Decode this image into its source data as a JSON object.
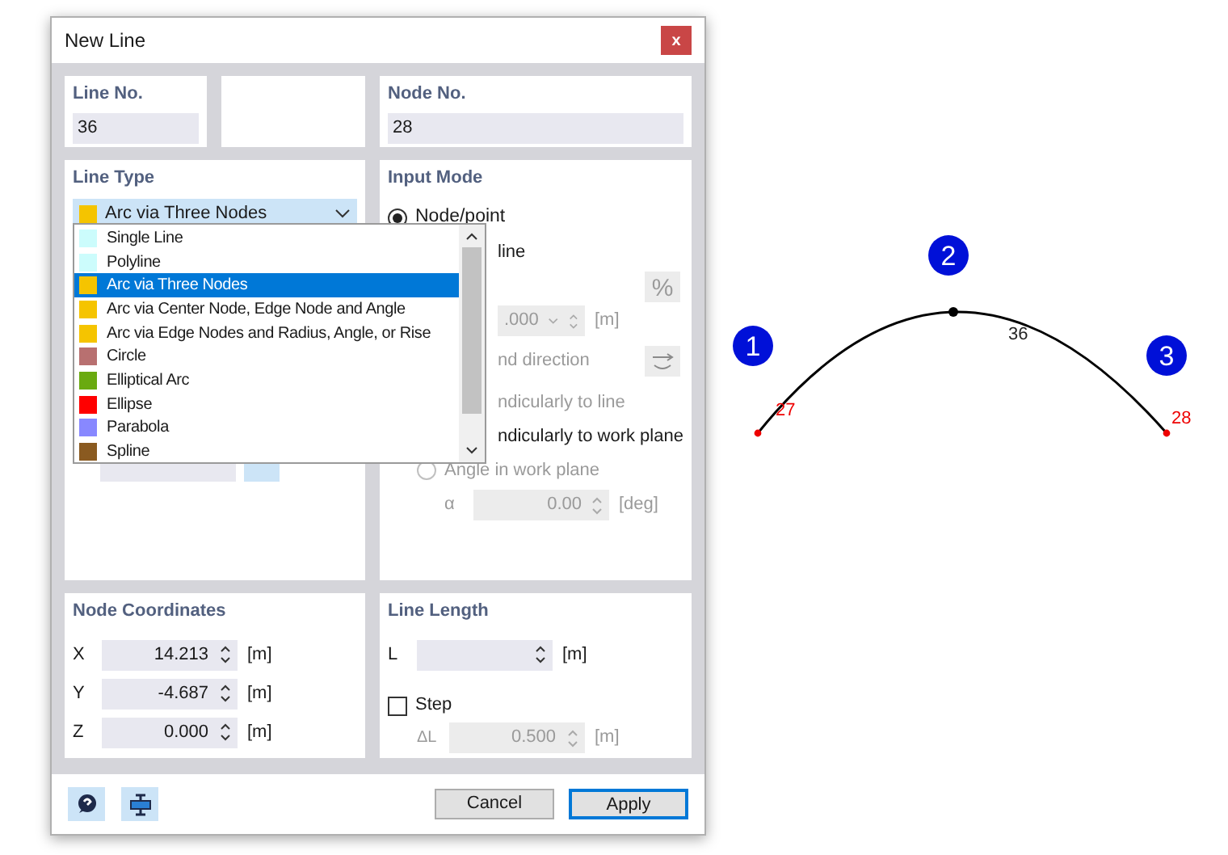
{
  "window": {
    "title": "New Line",
    "close": "x"
  },
  "line_no": {
    "label": "Line No.",
    "value": "36"
  },
  "node_no": {
    "label": "Node No.",
    "value": "28"
  },
  "line_type": {
    "label": "Line Type",
    "value": "Arc via Three Nodes",
    "color": "#f5c400",
    "expanded": true,
    "items": [
      {
        "label": "Single Line",
        "color": "#ccfcfc",
        "selected": false
      },
      {
        "label": "Polyline",
        "color": "#ccfcfc",
        "selected": false
      },
      {
        "label": "Arc via Three Nodes",
        "color": "#f5c400",
        "selected": true
      },
      {
        "label": "Arc via Center Node, Edge Node and Angle",
        "color": "#f5c400",
        "selected": false
      },
      {
        "label": "Arc via Edge Nodes and Radius, Angle, or Rise",
        "color": "#f5c400",
        "selected": false
      },
      {
        "label": "Circle",
        "color": "#b87070",
        "selected": false
      },
      {
        "label": "Elliptical Arc",
        "color": "#6aaa10",
        "selected": false
      },
      {
        "label": "Ellipse",
        "color": "#ff0000",
        "selected": false
      },
      {
        "label": "Parabola",
        "color": "#8888ff",
        "selected": false
      },
      {
        "label": "Spline",
        "color": "#8a5a20",
        "selected": false
      }
    ]
  },
  "input_mode": {
    "label": "Input Mode",
    "rows": [
      {
        "kind": "radio",
        "label": "Node/point",
        "selected": true,
        "disabled": false
      },
      {
        "kind": "text",
        "label": "line",
        "disabled": false
      },
      {
        "kind": "button",
        "label": "%",
        "disabled": true
      },
      {
        "kind": "field",
        "value": ".000",
        "unit": "[m]",
        "disabled": true
      },
      {
        "kind": "text_button",
        "label": "nd direction",
        "disabled": true
      },
      {
        "kind": "text",
        "label": "ndicularly to line",
        "disabled": true
      },
      {
        "kind": "text",
        "label": "ndicularly to work plane",
        "disabled": false
      },
      {
        "kind": "radio",
        "label": "Angle in work plane",
        "selected": false,
        "disabled": true
      },
      {
        "kind": "field",
        "label": "α",
        "value": "0.00",
        "unit": "[deg]",
        "disabled": true
      }
    ]
  },
  "node_coordinates": {
    "label": "Node Coordinates",
    "rows": [
      {
        "label": "X",
        "value": "14.213",
        "unit": "[m]"
      },
      {
        "label": "Y",
        "value": "-4.687",
        "unit": "[m]"
      },
      {
        "label": "Z",
        "value": "0.000",
        "unit": "[m]"
      }
    ]
  },
  "line_length": {
    "label": "Line Length",
    "length": {
      "label": "L",
      "unit": "[m]"
    },
    "step": {
      "label": "Step",
      "checked": false
    },
    "step_size": {
      "label": "ΔL",
      "value": "0.500",
      "unit": "[m]",
      "disabled": true
    }
  },
  "buttons": [
    {
      "label": "Cancel",
      "default": false
    },
    {
      "label": "Apply",
      "default": true
    }
  ],
  "drawing": {
    "line_label": "36",
    "start_node": "27",
    "end_node": "28",
    "markers": [
      "1",
      "2",
      "3"
    ]
  }
}
